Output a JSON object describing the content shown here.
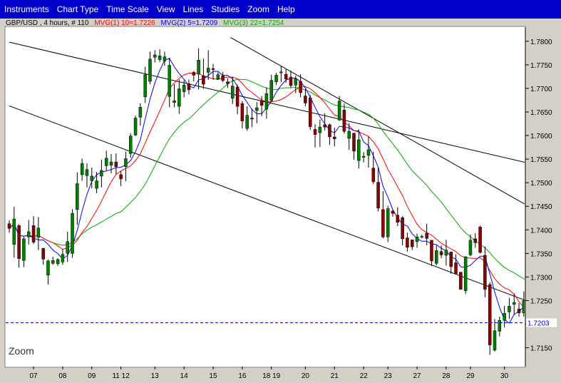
{
  "menu": {
    "items": [
      "Instruments",
      "Chart Type",
      "Time Scale",
      "View",
      "Lines",
      "Studies",
      "Zoom",
      "Help"
    ]
  },
  "legend": {
    "symbol_text": "GBP/USD , 4 hours, # 110",
    "ma1_text": "MVG(1) 10=1.7226",
    "ma2_text": "MVG(2) 5=1.7209",
    "ma3_text": "MVG(3) 22=1.7254",
    "ma1_color": "#ff0000",
    "ma2_color": "#0000ff",
    "ma3_color": "#00aa00"
  },
  "zoom_label": "Zoom",
  "current_price_label": "1.7203",
  "chart_data": {
    "type": "candlestick",
    "instrument": "GBP/USD",
    "ylim": [
      1.711,
      1.783
    ],
    "y_ticks": [
      "1.7800",
      "1.7750",
      "1.7700",
      "1.7650",
      "1.7600",
      "1.7550",
      "1.7500",
      "1.7450",
      "1.7400",
      "1.7350",
      "1.7300",
      "1.7250",
      "1.7200",
      "1.7150"
    ],
    "y_tick_values": [
      1.78,
      1.775,
      1.77,
      1.765,
      1.76,
      1.755,
      1.75,
      1.745,
      1.74,
      1.735,
      1.73,
      1.725,
      1.72,
      1.715
    ],
    "x_ticks": [
      {
        "label": "07",
        "index": 5
      },
      {
        "label": "08",
        "index": 11
      },
      {
        "label": "09",
        "index": 17
      },
      {
        "label": "11 12",
        "index": 23
      },
      {
        "label": "13",
        "index": 30
      },
      {
        "label": "14",
        "index": 36
      },
      {
        "label": "15",
        "index": 42
      },
      {
        "label": "16",
        "index": 48
      },
      {
        "label": "18 19",
        "index": 54
      },
      {
        "label": "20",
        "index": 61
      },
      {
        "label": "21",
        "index": 67
      },
      {
        "label": "22",
        "index": 73
      },
      {
        "label": "23",
        "index": 78
      },
      {
        "label": "27",
        "index": 84
      },
      {
        "label": "28",
        "index": 90
      },
      {
        "label": "29",
        "index": 95
      },
      {
        "label": "30",
        "index": 102
      }
    ],
    "current_price": 1.7203,
    "candles": [
      [
        1.7413,
        1.742,
        1.7394,
        1.7403
      ],
      [
        1.7369,
        1.7449,
        1.7341,
        1.7423
      ],
      [
        1.7409,
        1.7412,
        1.732,
        1.7339
      ],
      [
        1.7335,
        1.7385,
        1.7321,
        1.7381
      ],
      [
        1.7385,
        1.7421,
        1.7369,
        1.7396
      ],
      [
        1.7409,
        1.7429,
        1.737,
        1.7374
      ],
      [
        1.7384,
        1.7427,
        1.7357,
        1.7404
      ],
      [
        1.7361,
        1.7361,
        1.7326,
        1.7338
      ],
      [
        1.7304,
        1.7337,
        1.7284,
        1.7334
      ],
      [
        1.7329,
        1.7343,
        1.7326,
        1.7335
      ],
      [
        1.7328,
        1.734,
        1.7324,
        1.7337
      ],
      [
        1.7332,
        1.7359,
        1.7326,
        1.7348
      ],
      [
        1.735,
        1.7396,
        1.7332,
        1.7375
      ],
      [
        1.735,
        1.7444,
        1.7341,
        1.7435
      ],
      [
        1.7443,
        1.7522,
        1.7411,
        1.7498
      ],
      [
        1.7517,
        1.7551,
        1.7504,
        1.7541
      ],
      [
        1.7515,
        1.7541,
        1.749,
        1.7528
      ],
      [
        1.7504,
        1.7532,
        1.7488,
        1.7514
      ],
      [
        1.7488,
        1.7523,
        1.7478,
        1.7504
      ],
      [
        1.7514,
        1.7549,
        1.749,
        1.7526
      ],
      [
        1.7536,
        1.7568,
        1.7526,
        1.7552
      ],
      [
        1.7537,
        1.7561,
        1.752,
        1.7544
      ],
      [
        1.7544,
        1.7562,
        1.7518,
        1.7534
      ],
      [
        1.7517,
        1.7525,
        1.7493,
        1.7508
      ],
      [
        1.7534,
        1.7566,
        1.7503,
        1.7551
      ],
      [
        1.7562,
        1.7605,
        1.7553,
        1.7599
      ],
      [
        1.7601,
        1.7642,
        1.7599,
        1.7637
      ],
      [
        1.7639,
        1.7668,
        1.7621,
        1.766
      ],
      [
        1.7682,
        1.7746,
        1.7669,
        1.7729
      ],
      [
        1.7715,
        1.7778,
        1.7709,
        1.7762
      ],
      [
        1.7766,
        1.7781,
        1.7755,
        1.7771
      ],
      [
        1.7761,
        1.7783,
        1.7756,
        1.7769
      ],
      [
        1.7758,
        1.7778,
        1.7748,
        1.7767
      ],
      [
        1.7683,
        1.7765,
        1.766,
        1.7749
      ],
      [
        1.767,
        1.7709,
        1.766,
        1.7674
      ],
      [
        1.7662,
        1.7719,
        1.7646,
        1.7699
      ],
      [
        1.7693,
        1.7717,
        1.7681,
        1.7707
      ],
      [
        1.771,
        1.7719,
        1.7687,
        1.7697
      ],
      [
        1.7734,
        1.7737,
        1.7715,
        1.7728
      ],
      [
        1.773,
        1.7785,
        1.7698,
        1.776
      ],
      [
        1.7727,
        1.7763,
        1.7699,
        1.7709
      ],
      [
        1.7734,
        1.7781,
        1.7718,
        1.7743
      ],
      [
        1.7742,
        1.7752,
        1.7718,
        1.774
      ],
      [
        1.772,
        1.7734,
        1.7718,
        1.7729
      ],
      [
        1.7727,
        1.7735,
        1.7713,
        1.7717
      ],
      [
        1.7714,
        1.7721,
        1.7701,
        1.771
      ],
      [
        1.7679,
        1.7725,
        1.7667,
        1.7705
      ],
      [
        1.7703,
        1.7708,
        1.7645,
        1.7662
      ],
      [
        1.7668,
        1.7673,
        1.7615,
        1.7631
      ],
      [
        1.7615,
        1.7662,
        1.761,
        1.7643
      ],
      [
        1.7637,
        1.7657,
        1.7618,
        1.7635
      ],
      [
        1.7653,
        1.7671,
        1.7626,
        1.7659
      ],
      [
        1.7673,
        1.7684,
        1.7641,
        1.7664
      ],
      [
        1.7656,
        1.7702,
        1.7636,
        1.7689
      ],
      [
        1.7674,
        1.7729,
        1.7671,
        1.7717
      ],
      [
        1.7714,
        1.7733,
        1.7707,
        1.7728
      ],
      [
        1.7733,
        1.7747,
        1.7713,
        1.7735
      ],
      [
        1.773,
        1.7741,
        1.7712,
        1.772
      ],
      [
        1.7724,
        1.7738,
        1.7701,
        1.7706
      ],
      [
        1.7707,
        1.7727,
        1.769,
        1.772
      ],
      [
        1.7715,
        1.773,
        1.7681,
        1.7691
      ],
      [
        1.7684,
        1.7699,
        1.7662,
        1.7669
      ],
      [
        1.768,
        1.7686,
        1.7612,
        1.7619
      ],
      [
        1.7613,
        1.7624,
        1.7575,
        1.7602
      ],
      [
        1.7606,
        1.7634,
        1.7576,
        1.7618
      ],
      [
        1.7623,
        1.7647,
        1.7611,
        1.7618
      ],
      [
        1.7623,
        1.7625,
        1.758,
        1.7597
      ],
      [
        1.7597,
        1.7617,
        1.7577,
        1.7593
      ],
      [
        1.7633,
        1.7684,
        1.7631,
        1.7673
      ],
      [
        1.7654,
        1.7668,
        1.7604,
        1.7609
      ],
      [
        1.7594,
        1.7626,
        1.757,
        1.7609
      ],
      [
        1.7605,
        1.7606,
        1.7549,
        1.7567
      ],
      [
        1.7547,
        1.7613,
        1.753,
        1.7591
      ],
      [
        1.7554,
        1.7565,
        1.7543,
        1.7556
      ],
      [
        1.7558,
        1.7598,
        1.7532,
        1.757
      ],
      [
        1.7531,
        1.7566,
        1.7497,
        1.7502
      ],
      [
        1.7501,
        1.7532,
        1.7439,
        1.7446
      ],
      [
        1.7443,
        1.7482,
        1.7382,
        1.7385
      ],
      [
        1.7385,
        1.7451,
        1.7374,
        1.7445
      ],
      [
        1.744,
        1.7441,
        1.7428,
        1.7435
      ],
      [
        1.7431,
        1.7448,
        1.7408,
        1.7416
      ],
      [
        1.7426,
        1.7429,
        1.7367,
        1.7381
      ],
      [
        1.7383,
        1.7394,
        1.7354,
        1.7363
      ],
      [
        1.7379,
        1.7379,
        1.7357,
        1.7364
      ],
      [
        1.7375,
        1.7392,
        1.7362,
        1.7385
      ],
      [
        1.7385,
        1.739,
        1.7382,
        1.7386
      ],
      [
        1.7393,
        1.7413,
        1.7367,
        1.7382
      ],
      [
        1.7378,
        1.7378,
        1.7323,
        1.7334
      ],
      [
        1.7329,
        1.7367,
        1.7325,
        1.7356
      ],
      [
        1.7354,
        1.7367,
        1.734,
        1.7347
      ],
      [
        1.7346,
        1.7379,
        1.7324,
        1.7357
      ],
      [
        1.7353,
        1.7354,
        1.7307,
        1.7322
      ],
      [
        1.733,
        1.7348,
        1.7306,
        1.7307
      ],
      [
        1.731,
        1.7311,
        1.7273,
        1.7274
      ],
      [
        1.7271,
        1.7344,
        1.7264,
        1.7343
      ],
      [
        1.7347,
        1.739,
        1.7344,
        1.7378
      ],
      [
        1.7381,
        1.7393,
        1.7362,
        1.7373
      ],
      [
        1.7406,
        1.7409,
        1.735,
        1.7352
      ],
      [
        1.7346,
        1.7365,
        1.7257,
        1.7274
      ],
      [
        1.7284,
        1.7289,
        1.7135,
        1.7156
      ],
      [
        1.7145,
        1.7211,
        1.7142,
        1.7186
      ],
      [
        1.7185,
        1.7216,
        1.7174,
        1.7208
      ],
      [
        1.7208,
        1.7239,
        1.7193,
        1.7223
      ],
      [
        1.7226,
        1.7256,
        1.7211,
        1.7238
      ],
      [
        1.7242,
        1.7265,
        1.722,
        1.7246
      ],
      [
        1.7232,
        1.7245,
        1.7216,
        1.7224
      ],
      [
        1.7224,
        1.7269,
        1.7216,
        1.725
      ],
      [
        1.7254,
        1.7286,
        1.7245,
        1.7272
      ],
      [
        1.7243,
        1.7265,
        1.7216,
        1.7225
      ],
      [
        1.7203,
        1.7211,
        1.7176,
        1.7203
      ]
    ],
    "channel_lines": [
      {
        "x1": 0,
        "y1": 1.7798,
        "x2": 125.5,
        "y2": 1.7497
      },
      {
        "x1": 0,
        "y1": 1.7663,
        "x2": 125.5,
        "y2": 1.7176
      },
      {
        "x1": 45.6,
        "y1": 1.7808,
        "x2": 125.5,
        "y2": 1.7342
      }
    ]
  }
}
